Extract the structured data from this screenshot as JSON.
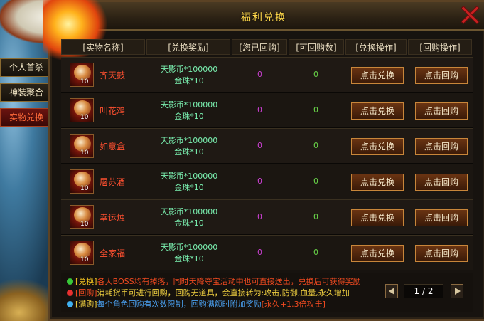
{
  "title": "福利兑换",
  "side_tabs": [
    {
      "label": "个人首杀",
      "active": false
    },
    {
      "label": "神装聚合",
      "active": false
    },
    {
      "label": "实物兑换",
      "active": true
    }
  ],
  "columns": [
    "[实物名称]",
    "[兑换奖励]",
    "[您已回购]",
    "[可回购数]",
    "[兑换操作]",
    "[回购操作]"
  ],
  "rows": [
    {
      "name": "齐天鼓",
      "count": "10",
      "reward_line1": "天影币*100000",
      "reward_line2": "金珠*10",
      "bought": "0",
      "available": "0",
      "exchange": "点击兑换",
      "buyback": "点击回购"
    },
    {
      "name": "叫花鸡",
      "count": "10",
      "reward_line1": "天影币*100000",
      "reward_line2": "金珠*10",
      "bought": "0",
      "available": "0",
      "exchange": "点击兑换",
      "buyback": "点击回购"
    },
    {
      "name": "如意盒",
      "count": "10",
      "reward_line1": "天影币*100000",
      "reward_line2": "金珠*10",
      "bought": "0",
      "available": "0",
      "exchange": "点击兑换",
      "buyback": "点击回购"
    },
    {
      "name": "屠苏酒",
      "count": "10",
      "reward_line1": "天影币*100000",
      "reward_line2": "金珠*10",
      "bought": "0",
      "available": "0",
      "exchange": "点击兑换",
      "buyback": "点击回购"
    },
    {
      "name": "幸运烛",
      "count": "10",
      "reward_line1": "天影币*100000",
      "reward_line2": "金珠*10",
      "bought": "0",
      "available": "0",
      "exchange": "点击兑换",
      "buyback": "点击回购"
    },
    {
      "name": "全家福",
      "count": "10",
      "reward_line1": "天影币*100000",
      "reward_line2": "金珠*10",
      "bought": "0",
      "available": "0",
      "exchange": "点击兑换",
      "buyback": "点击回购"
    }
  ],
  "notes": [
    {
      "tag": "[兑换]",
      "text": "各大BOSS均有掉落，同时天降夺宝活动中也可直接送出，兑换后可获得奖励",
      "dot_color": "#38c838",
      "tag_color": "#f0c020",
      "text_color": "#f04a20"
    },
    {
      "tag": "[回购]",
      "text": "消耗货币可进行回购，回购无道具，会直接转为:攻击,防御,血量,永久增加",
      "dot_color": "#e83030",
      "tag_color": "#f04a20",
      "text_color": "#f0d040"
    },
    {
      "tag": "[满购]",
      "text": "每个角色回购有次数限制，回购满额时附加奖励",
      "extra": "[永久+1.3倍攻击]",
      "dot_color": "#40b0f0",
      "tag_color": "#f0d040",
      "text_color": "#4aa0f0",
      "extra_color": "#f04a20"
    }
  ],
  "pager": {
    "current": "1",
    "separator": "/",
    "total": "2"
  }
}
